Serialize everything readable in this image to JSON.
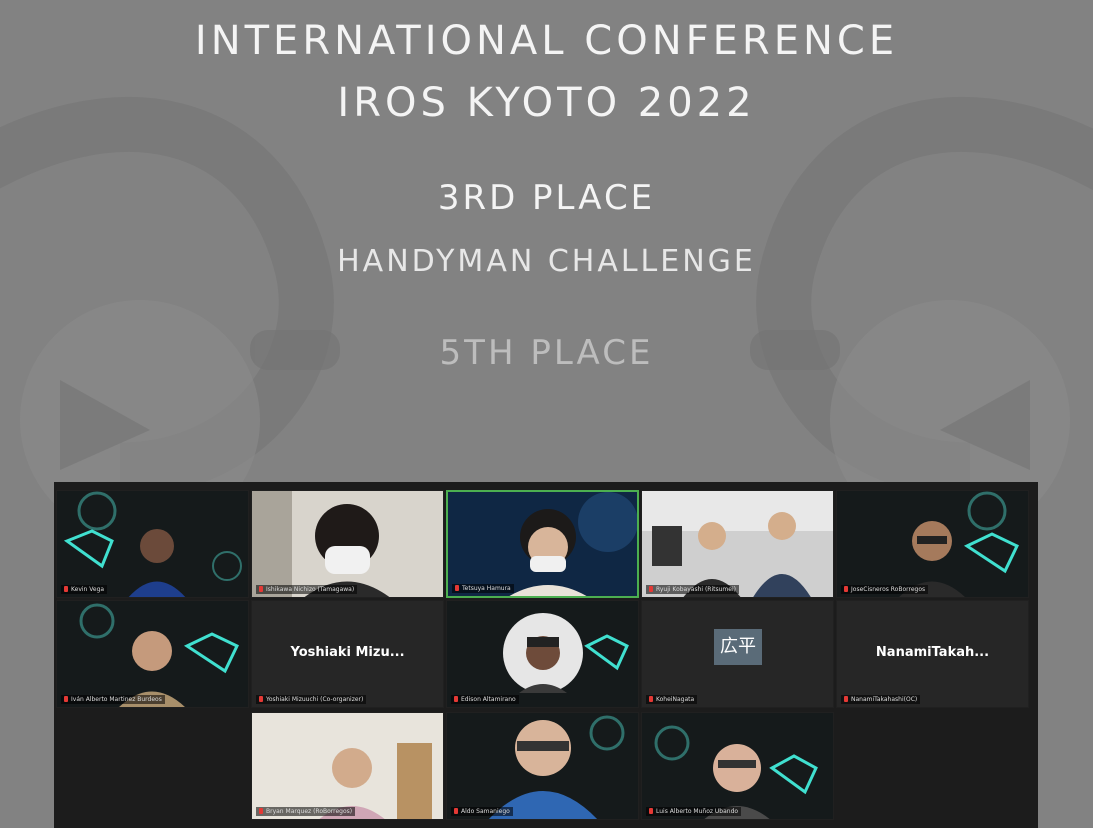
{
  "slide": {
    "title_line1": "INTERNATIONAL CONFERENCE",
    "title_line2": "IROS KYOTO 2022",
    "award1": "3RD PLACE",
    "challenge": "HANDYMAN CHALLENGE",
    "award2": "5TH PLACE"
  },
  "participants": [
    {
      "name": "Kevin Vega"
    },
    {
      "name": "Ishikawa Nichizo (Tamagawa)"
    },
    {
      "name": "Tetsuya Hamura"
    },
    {
      "name": "Ryuji Kobayashi (Ritsumei)"
    },
    {
      "name": "JoseCisneros RoBorregos"
    },
    {
      "name": "Iván Alberto Martinez Burdeos"
    },
    {
      "name": "Yoshiaki Mizu...",
      "label": "Yoshiaki Mizuuchi (Co-organizer)"
    },
    {
      "name": "Edison Altamirano"
    },
    {
      "name": "KoheiNagata",
      "avatar_text": "広平"
    },
    {
      "name": "NanamiTakah...",
      "label": "NanamiTakahashi(OC)"
    },
    {
      "name": "Bryan Marquez (RoBorregos)"
    },
    {
      "name": "Aldo Samaniego"
    },
    {
      "name": "Luis Alberto Muñoz Ubando"
    }
  ],
  "colors": {
    "background": "#828282",
    "active_speaker_border": "#4caf50",
    "gallery_bg": "#1c1c1c",
    "robot_logo": "#40e0d0",
    "muted_mic": "#e53935"
  }
}
